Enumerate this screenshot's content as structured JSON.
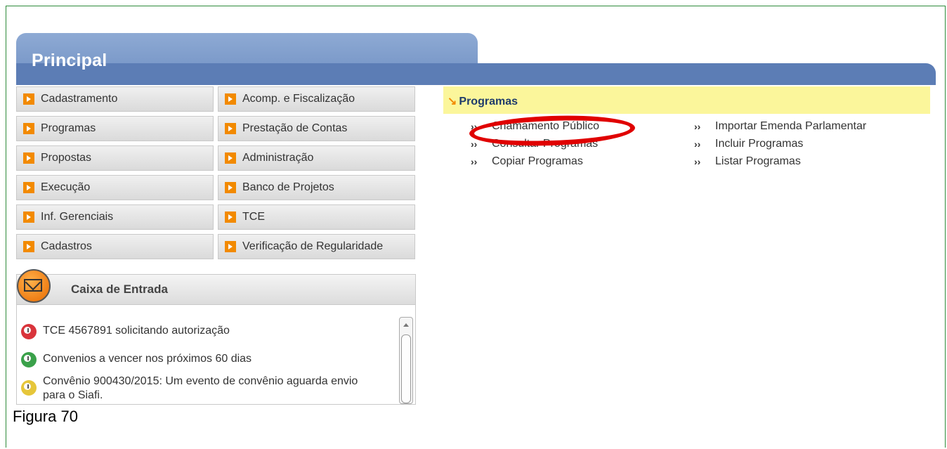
{
  "header": {
    "title": "Principal"
  },
  "menu": {
    "left": [
      "Cadastramento",
      "Programas",
      "Propostas",
      "Execução",
      "Inf. Gerenciais",
      "Cadastros"
    ],
    "right": [
      "Acomp. e Fiscalização",
      "Prestação de Contas",
      "Administração",
      "Banco de Projetos",
      "TCE",
      "Verificação de Regularidade"
    ]
  },
  "inbox": {
    "title": "Caixa de Entrada",
    "messages": [
      {
        "text": "TCE 4567891 solicitando autorização",
        "color": "#d9343b"
      },
      {
        "text": "Convenios a vencer nos próximos 60 dias",
        "color": "#3aa14a"
      },
      {
        "text": "Convênio 900430/2015: Um evento de convênio aguarda envio para o Siafi.",
        "color": "#e6c63a"
      }
    ]
  },
  "programas": {
    "title": "Programas",
    "col1": [
      "Chamamento Público",
      "Consultar Programas",
      "Copiar Programas"
    ],
    "col2": [
      "Importar Emenda Parlamentar",
      "Incluir Programas",
      "Listar Programas"
    ]
  },
  "caption": "Figura 70"
}
